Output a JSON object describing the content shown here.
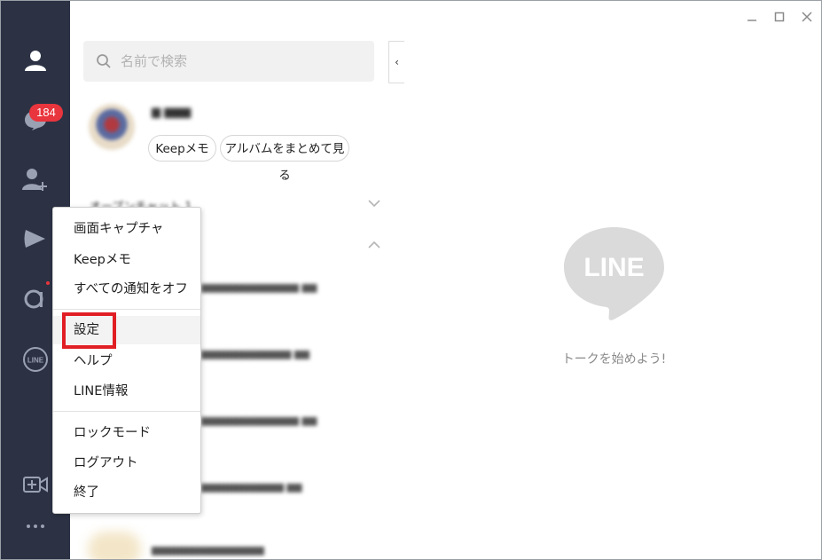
{
  "rail": {
    "chat_badge": "184",
    "items": [
      "friends-icon",
      "chats-icon",
      "add-friend-icon",
      "line-voom-icon",
      "openchat-icon",
      "line-icon",
      "video-call-icon",
      "more-icon"
    ]
  },
  "search": {
    "placeholder": "名前で検索"
  },
  "profile": {
    "buttons": [
      "Keepメモ",
      "アルバムをまとめて見る"
    ]
  },
  "section": {
    "open_chat_label": "オープンチャット 1"
  },
  "empty_state": {
    "logo_text": "LINE",
    "message": "トークを始めよう!"
  },
  "menu": {
    "items": [
      "画面キャプチャ",
      "Keepメモ",
      "すべての通知をオフ",
      "設定",
      "ヘルプ",
      "LINE情報",
      "ロックモード",
      "ログアウト",
      "終了"
    ],
    "highlighted": "設定"
  },
  "colors": {
    "rail": "#2c3244",
    "badge": "#e9353d",
    "highlight": "#e01e24"
  }
}
